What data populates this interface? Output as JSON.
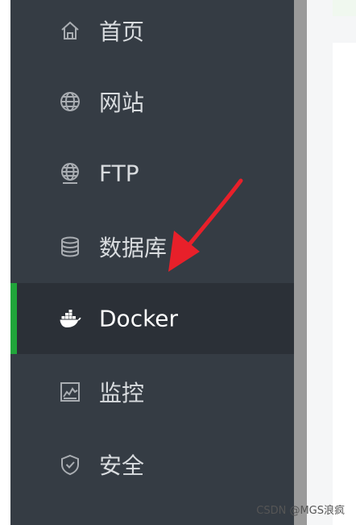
{
  "sidebar": {
    "items": [
      {
        "label": "首页",
        "icon": "home-icon",
        "active": false
      },
      {
        "label": "网站",
        "icon": "globe-icon",
        "active": false
      },
      {
        "label": "FTP",
        "icon": "ftp-globe-icon",
        "active": false
      },
      {
        "label": "数据库",
        "icon": "database-icon",
        "active": false
      },
      {
        "label": "Docker",
        "icon": "docker-icon",
        "active": true
      },
      {
        "label": "监控",
        "icon": "monitor-chart-icon",
        "active": false
      },
      {
        "label": "安全",
        "icon": "shield-icon",
        "active": false
      }
    ]
  },
  "annotation": {
    "type": "arrow",
    "color": "#e8202a"
  },
  "watermark": "CSDN @MGS浪疯",
  "colors": {
    "sidebar_bg": "#353c44",
    "active_bg": "#2b3037",
    "active_indicator": "#20a53a",
    "text": "#d9dcdf",
    "icon": "#a9adb2"
  }
}
